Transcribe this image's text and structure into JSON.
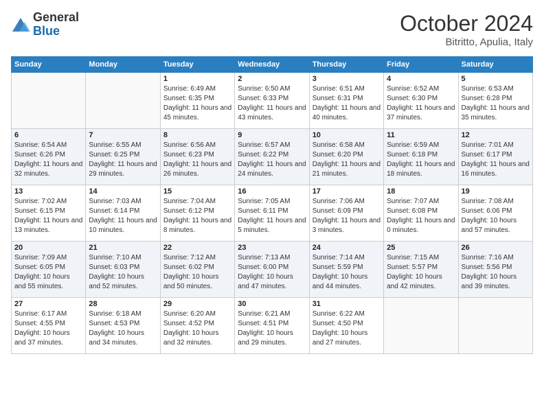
{
  "logo": {
    "general": "General",
    "blue": "Blue"
  },
  "title": "October 2024",
  "location": "Bitritto, Apulia, Italy",
  "weekdays": [
    "Sunday",
    "Monday",
    "Tuesday",
    "Wednesday",
    "Thursday",
    "Friday",
    "Saturday"
  ],
  "weeks": [
    [
      {
        "day": "",
        "info": ""
      },
      {
        "day": "",
        "info": ""
      },
      {
        "day": "1",
        "info": "Sunrise: 6:49 AM\nSunset: 6:35 PM\nDaylight: 11 hours and 45 minutes."
      },
      {
        "day": "2",
        "info": "Sunrise: 6:50 AM\nSunset: 6:33 PM\nDaylight: 11 hours and 43 minutes."
      },
      {
        "day": "3",
        "info": "Sunrise: 6:51 AM\nSunset: 6:31 PM\nDaylight: 11 hours and 40 minutes."
      },
      {
        "day": "4",
        "info": "Sunrise: 6:52 AM\nSunset: 6:30 PM\nDaylight: 11 hours and 37 minutes."
      },
      {
        "day": "5",
        "info": "Sunrise: 6:53 AM\nSunset: 6:28 PM\nDaylight: 11 hours and 35 minutes."
      }
    ],
    [
      {
        "day": "6",
        "info": "Sunrise: 6:54 AM\nSunset: 6:26 PM\nDaylight: 11 hours and 32 minutes."
      },
      {
        "day": "7",
        "info": "Sunrise: 6:55 AM\nSunset: 6:25 PM\nDaylight: 11 hours and 29 minutes."
      },
      {
        "day": "8",
        "info": "Sunrise: 6:56 AM\nSunset: 6:23 PM\nDaylight: 11 hours and 26 minutes."
      },
      {
        "day": "9",
        "info": "Sunrise: 6:57 AM\nSunset: 6:22 PM\nDaylight: 11 hours and 24 minutes."
      },
      {
        "day": "10",
        "info": "Sunrise: 6:58 AM\nSunset: 6:20 PM\nDaylight: 11 hours and 21 minutes."
      },
      {
        "day": "11",
        "info": "Sunrise: 6:59 AM\nSunset: 6:18 PM\nDaylight: 11 hours and 18 minutes."
      },
      {
        "day": "12",
        "info": "Sunrise: 7:01 AM\nSunset: 6:17 PM\nDaylight: 11 hours and 16 minutes."
      }
    ],
    [
      {
        "day": "13",
        "info": "Sunrise: 7:02 AM\nSunset: 6:15 PM\nDaylight: 11 hours and 13 minutes."
      },
      {
        "day": "14",
        "info": "Sunrise: 7:03 AM\nSunset: 6:14 PM\nDaylight: 11 hours and 10 minutes."
      },
      {
        "day": "15",
        "info": "Sunrise: 7:04 AM\nSunset: 6:12 PM\nDaylight: 11 hours and 8 minutes."
      },
      {
        "day": "16",
        "info": "Sunrise: 7:05 AM\nSunset: 6:11 PM\nDaylight: 11 hours and 5 minutes."
      },
      {
        "day": "17",
        "info": "Sunrise: 7:06 AM\nSunset: 6:09 PM\nDaylight: 11 hours and 3 minutes."
      },
      {
        "day": "18",
        "info": "Sunrise: 7:07 AM\nSunset: 6:08 PM\nDaylight: 11 hours and 0 minutes."
      },
      {
        "day": "19",
        "info": "Sunrise: 7:08 AM\nSunset: 6:06 PM\nDaylight: 10 hours and 57 minutes."
      }
    ],
    [
      {
        "day": "20",
        "info": "Sunrise: 7:09 AM\nSunset: 6:05 PM\nDaylight: 10 hours and 55 minutes."
      },
      {
        "day": "21",
        "info": "Sunrise: 7:10 AM\nSunset: 6:03 PM\nDaylight: 10 hours and 52 minutes."
      },
      {
        "day": "22",
        "info": "Sunrise: 7:12 AM\nSunset: 6:02 PM\nDaylight: 10 hours and 50 minutes."
      },
      {
        "day": "23",
        "info": "Sunrise: 7:13 AM\nSunset: 6:00 PM\nDaylight: 10 hours and 47 minutes."
      },
      {
        "day": "24",
        "info": "Sunrise: 7:14 AM\nSunset: 5:59 PM\nDaylight: 10 hours and 44 minutes."
      },
      {
        "day": "25",
        "info": "Sunrise: 7:15 AM\nSunset: 5:57 PM\nDaylight: 10 hours and 42 minutes."
      },
      {
        "day": "26",
        "info": "Sunrise: 7:16 AM\nSunset: 5:56 PM\nDaylight: 10 hours and 39 minutes."
      }
    ],
    [
      {
        "day": "27",
        "info": "Sunrise: 6:17 AM\nSunset: 4:55 PM\nDaylight: 10 hours and 37 minutes."
      },
      {
        "day": "28",
        "info": "Sunrise: 6:18 AM\nSunset: 4:53 PM\nDaylight: 10 hours and 34 minutes."
      },
      {
        "day": "29",
        "info": "Sunrise: 6:20 AM\nSunset: 4:52 PM\nDaylight: 10 hours and 32 minutes."
      },
      {
        "day": "30",
        "info": "Sunrise: 6:21 AM\nSunset: 4:51 PM\nDaylight: 10 hours and 29 minutes."
      },
      {
        "day": "31",
        "info": "Sunrise: 6:22 AM\nSunset: 4:50 PM\nDaylight: 10 hours and 27 minutes."
      },
      {
        "day": "",
        "info": ""
      },
      {
        "day": "",
        "info": ""
      }
    ]
  ]
}
